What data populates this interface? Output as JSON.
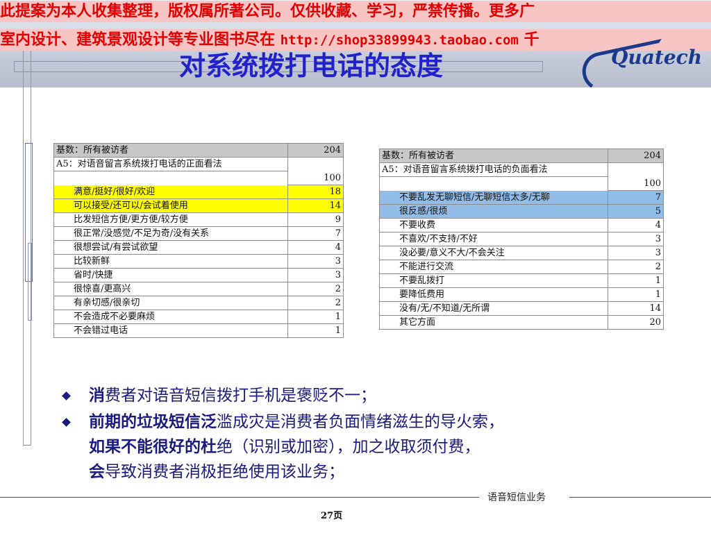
{
  "watermark": {
    "line1": "此提案为本人收集整理，版权属所著公司。仅供收藏、学习，严禁传播。更多广",
    "line2_prefix": "室内设计、建筑景观设计等专业图书尽在 ",
    "line2_url": "http://shop33899943.taobao.com",
    "line2_suffix": " 千"
  },
  "title": "对系统拨打电话的态度",
  "logo_text": "Quatech",
  "table_positive": {
    "base_label": "基数：所有被访者",
    "base_value": "204",
    "question": "A5：对语音留言系统拨打电话的正面看法",
    "total": "100",
    "rows": [
      {
        "label": "满意/挺好/很好/欢迎",
        "value": "18"
      },
      {
        "label": "可以接受/还可以/会试着使用",
        "value": "14"
      },
      {
        "label": "比发短信方便/更方便/较方便",
        "value": "9"
      },
      {
        "label": "很正常/没感觉/不足为奇/没有关系",
        "value": "7"
      },
      {
        "label": "很想尝试/有尝试欲望",
        "value": "4"
      },
      {
        "label": "比较新鲜",
        "value": "3"
      },
      {
        "label": "省时/快捷",
        "value": "3"
      },
      {
        "label": "很惊喜/更高兴",
        "value": "2"
      },
      {
        "label": "有亲切感/很亲切",
        "value": "2"
      },
      {
        "label": "不会造成不必要麻烦",
        "value": "1"
      },
      {
        "label": "不会错过电话",
        "value": "1"
      }
    ]
  },
  "table_negative": {
    "base_label": "基数：所有被访者",
    "base_value": "204",
    "question": "A5：对语音留言系统拨打电话的负面看法",
    "total": "100",
    "rows": [
      {
        "label": "不要乱发无聊短信/无聊短信太多/无聊",
        "value": "7"
      },
      {
        "label": "很反感/很烦",
        "value": "5"
      },
      {
        "label": "不要收费",
        "value": "4"
      },
      {
        "label": "不喜欢/不支持/不好",
        "value": "3"
      },
      {
        "label": "没必要/意义不大/不会关注",
        "value": "3"
      },
      {
        "label": "不能进行交流",
        "value": "2"
      },
      {
        "label": "不要乱拨打",
        "value": "1"
      },
      {
        "label": "要降低费用",
        "value": "1"
      },
      {
        "label": "没有/无/不知道/无所谓",
        "value": "14"
      },
      {
        "label": "其它方面",
        "value": "20"
      }
    ]
  },
  "bullets": {
    "b1_bold": "消",
    "b1_rest": "费者对语音短信拨打手机是褒贬不一；",
    "b2_l1_bold": "前期的垃圾短信泛",
    "b2_l1_rest": "滥成灾是消费者负面情绪滋生的导火索，",
    "b2_l2_bold": "如果不能很好的杜",
    "b2_l2_rest": "绝（识别或加密），加之收取须付费，",
    "b2_l3_bold": "会",
    "b2_l3_rest": "导致消费者消极拒绝使用该业务；"
  },
  "footer": {
    "label": "语音短信业务",
    "page": "27页"
  },
  "colors": {
    "title": "#2222cc",
    "watermark_text": "#e10000",
    "watermark_bg": "#f7c4c4",
    "highlight_positive": "#ffff00",
    "highlight_negative": "#92bde8",
    "bullet_text": "#1a1a80"
  }
}
